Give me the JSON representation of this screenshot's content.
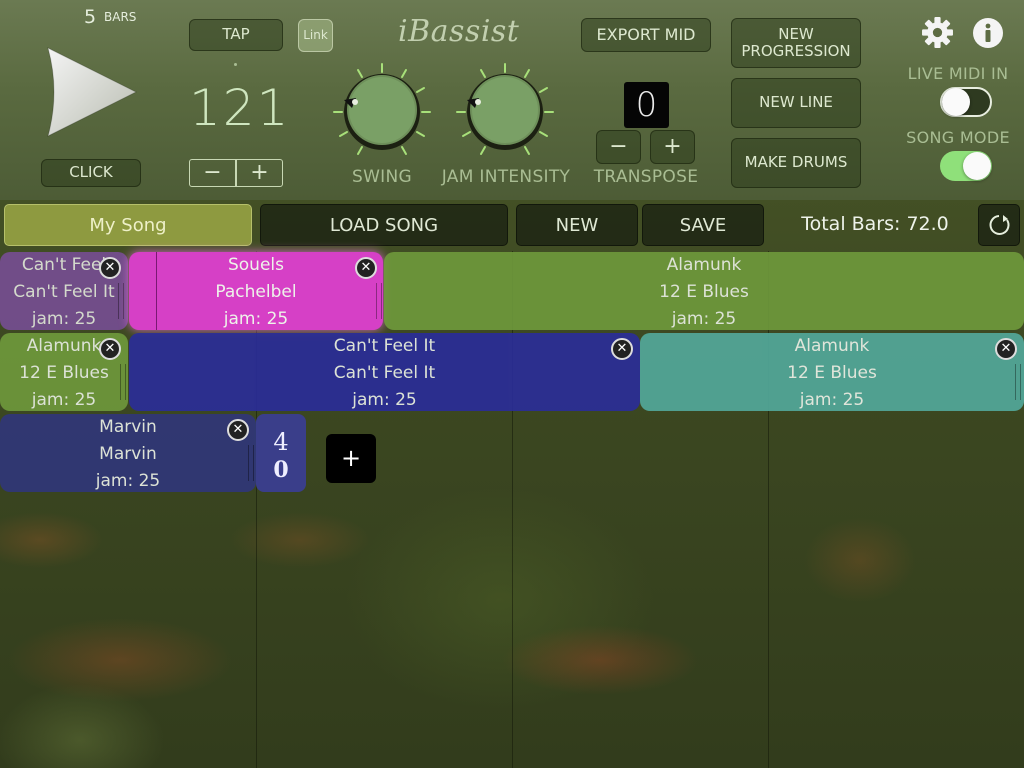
{
  "transport": {
    "bars_count": "5",
    "bars_label": "BARS",
    "click_label": "CLICK"
  },
  "tempo": {
    "tap_label": "TAP",
    "link_label": "Link",
    "bpm": "121",
    "minus": "−",
    "plus": "+"
  },
  "logo": {
    "text": "iBassist"
  },
  "knobs": {
    "swing_label": "SWING",
    "jam_label": "JAM INTENSITY"
  },
  "transpose": {
    "export_label": "EXPORT MID",
    "value": "0",
    "minus": "−",
    "plus": "+",
    "label": "TRANSPOSE"
  },
  "actions": {
    "new_progression": "NEW PROGRESSION",
    "new_line": "NEW LINE",
    "make_drums": "MAKE DRUMS"
  },
  "settings": {
    "live_midi_label": "LIVE MIDI IN",
    "live_midi_on": false,
    "song_mode_label": "SONG MODE",
    "song_mode_on": true,
    "gear_icon": "gear-icon",
    "info_icon": "info-icon",
    "accent_color": "#8fe07a"
  },
  "songbar": {
    "song_name": "My Song",
    "load_label": "LOAD SONG",
    "new_label": "NEW",
    "save_label": "SAVE",
    "total_bars": "Total Bars: 72.0"
  },
  "blocks": [
    {
      "line1": "Can't Feel",
      "line2": "Can't Feel It",
      "line3": "jam: 25",
      "color": "#7a4e9a"
    },
    {
      "line1": "Souels",
      "line2": "Pachelbel",
      "line3": "jam: 25",
      "color": "#d640c6"
    },
    {
      "line1": "Alamunk",
      "line2": "12 E Blues",
      "line3": "jam: 25",
      "color": "#6f9a3c"
    },
    {
      "line1": "Alamunk",
      "line2": "12 E Blues",
      "line3": "jam: 25",
      "color": "#6f9a3c"
    },
    {
      "line1": "Can't Feel It",
      "line2": "Can't Feel It",
      "line3": "jam: 25",
      "color": "#2a2c9a"
    },
    {
      "line1": "Alamunk",
      "line2": "12 E Blues",
      "line3": "jam: 25",
      "color": "#52a89a"
    },
    {
      "line1": "Marvin",
      "line2": "Marvin",
      "line3": "jam: 25",
      "color": "#30367a"
    }
  ],
  "time_signature": {
    "top": "4",
    "bottom": "0"
  },
  "add_block": {
    "label": "+"
  }
}
